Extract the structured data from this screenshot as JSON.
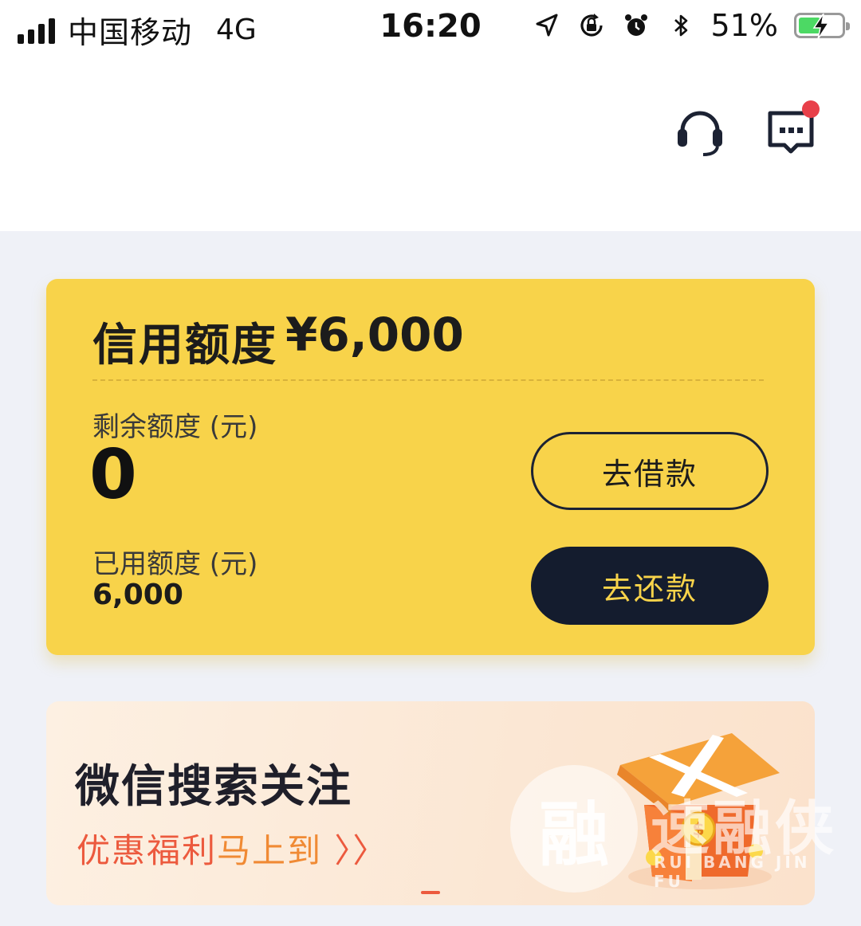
{
  "status_bar": {
    "carrier": "中国移动",
    "network": "4G",
    "time": "16:20",
    "battery_percent": "51%",
    "battery_level": 0.51,
    "icons": [
      "location-arrow-icon",
      "rotation-lock-icon",
      "alarm-clock-icon",
      "bluetooth-icon",
      "battery-charging-icon"
    ]
  },
  "header": {
    "icons": [
      "headset-icon",
      "message-icon"
    ],
    "badge_color": "#e8404a"
  },
  "credit_card": {
    "title": "信用额度",
    "amount": "¥6,000",
    "remaining_label": "剩余额度 (元)",
    "remaining_value": "0",
    "used_label": "已用额度 (元)",
    "used_value": "6,000",
    "borrow_button": "去借款",
    "repay_button": "去还款",
    "accent_color": "#f8d34a",
    "dark_color": "#141c2e"
  },
  "promo_banner": {
    "title": "微信搜索关注",
    "subtitle_part1": "优惠福利",
    "subtitle_part2": "马上到",
    "subtitle_chevron": "〉〉",
    "accent_color": "#ec5a3e",
    "illustration": "gift-box-icon"
  },
  "watermark": {
    "logo_char": "融",
    "name": "速融侠",
    "sub": "RUI BANG JIN FU"
  }
}
